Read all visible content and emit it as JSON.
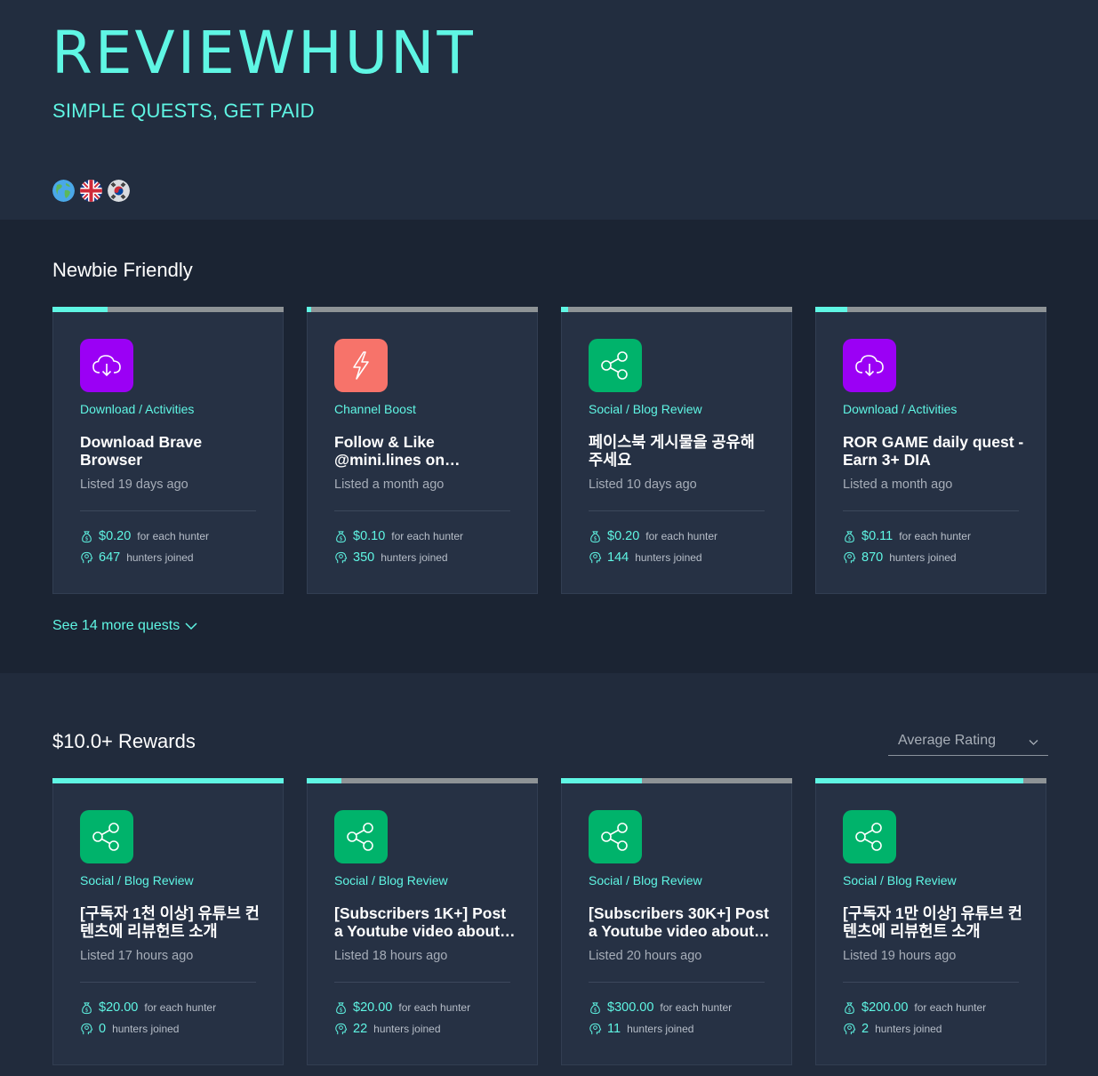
{
  "brand": {
    "logo": "REVIEWHUNT",
    "tagline": "SIMPLE QUESTS, GET PAID"
  },
  "languages": [
    {
      "name": "globe-icon"
    },
    {
      "name": "uk-flag-icon"
    },
    {
      "name": "korea-flag-icon"
    }
  ],
  "colors": {
    "accent": "#5ff6e4",
    "download": "#9b00f5",
    "boost": "#f7736a",
    "social": "#00b36b"
  },
  "sections": [
    {
      "title": "Newbie Friendly",
      "see_more": "See 14 more quests",
      "cards": [
        {
          "progress": 0.24,
          "icon": "cloud-download-icon",
          "category": "Download / Activities",
          "title": "Download Brave Browser",
          "listed": "Listed 19 days ago",
          "reward": "$0.20",
          "reward_suffix": "for each hunter",
          "hunters": "647",
          "hunters_suffix": "hunters joined"
        },
        {
          "progress": 0.02,
          "icon": "lightning-icon",
          "category": "Channel Boost",
          "title": "Follow & Like @mini.lines on…",
          "listed": "Listed a month ago",
          "reward": "$0.10",
          "reward_suffix": "for each hunter",
          "hunters": "350",
          "hunters_suffix": "hunters joined"
        },
        {
          "progress": 0.03,
          "icon": "share-icon",
          "category": "Social / Blog Review",
          "title": "페이스북 게시물을 공유해 주세요",
          "listed": "Listed 10 days ago",
          "reward": "$0.20",
          "reward_suffix": "for each hunter",
          "hunters": "144",
          "hunters_suffix": "hunters joined"
        },
        {
          "progress": 0.14,
          "icon": "cloud-download-icon",
          "category": "Download / Activities",
          "title": "ROR GAME daily quest - Earn 3+ DIA",
          "listed": "Listed a month ago",
          "reward": "$0.11",
          "reward_suffix": "for each hunter",
          "hunters": "870",
          "hunters_suffix": "hunters joined"
        }
      ]
    },
    {
      "title": "$10.0+ Rewards",
      "sort_label": "Average Rating",
      "cards": [
        {
          "progress": 1.0,
          "icon": "share-icon",
          "category": "Social / Blog Review",
          "title": "[구독자 1천 이상] 유튜브 컨텐츠에 리뷰헌트 소개",
          "listed": "Listed 17 hours ago",
          "reward": "$20.00",
          "reward_suffix": "for each hunter",
          "hunters": "0",
          "hunters_suffix": "hunters joined"
        },
        {
          "progress": 0.15,
          "icon": "share-icon",
          "category": "Social / Blog Review",
          "title": "[Subscribers 1K+] Post a Youtube video about…",
          "listed": "Listed 18 hours ago",
          "reward": "$20.00",
          "reward_suffix": "for each hunter",
          "hunters": "22",
          "hunters_suffix": "hunters joined"
        },
        {
          "progress": 0.35,
          "icon": "share-icon",
          "category": "Social / Blog Review",
          "title": "[Subscribers 30K+] Post a Youtube video about…",
          "listed": "Listed 20 hours ago",
          "reward": "$300.00",
          "reward_suffix": "for each hunter",
          "hunters": "11",
          "hunters_suffix": "hunters joined"
        },
        {
          "progress": 0.9,
          "icon": "share-icon",
          "category": "Social / Blog Review",
          "title": "[구독자 1만 이상] 유튜브 컨텐츠에 리뷰헌트 소개",
          "listed": "Listed 19 hours ago",
          "reward": "$200.00",
          "reward_suffix": "for each hunter",
          "hunters": "2",
          "hunters_suffix": "hunters joined"
        }
      ]
    }
  ]
}
